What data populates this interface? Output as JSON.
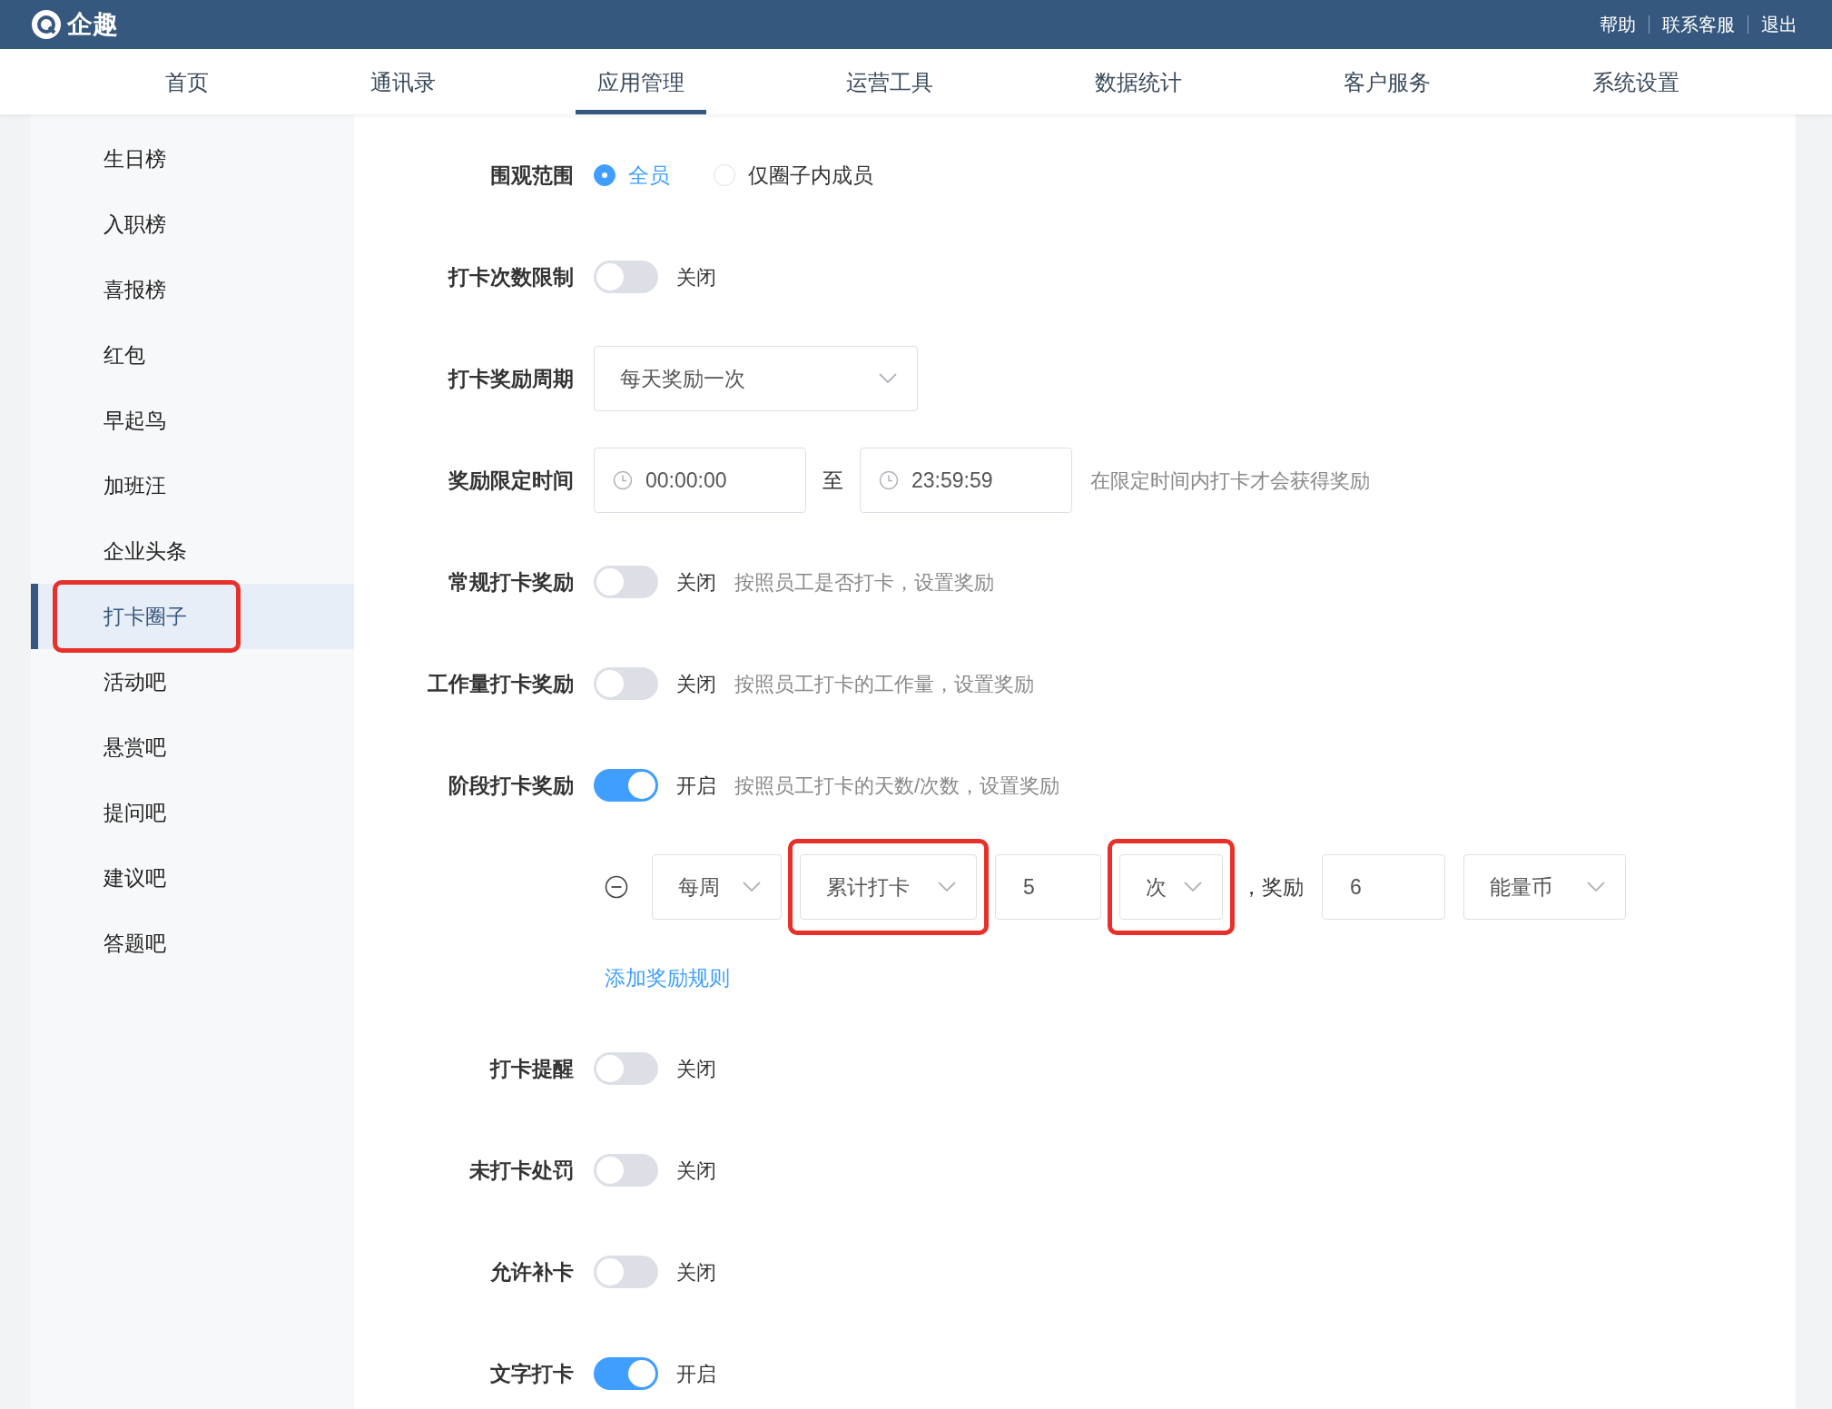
{
  "header": {
    "logo_text": "企趣",
    "links": [
      "帮助",
      "联系客服",
      "退出"
    ]
  },
  "nav": [
    {
      "label": "首页",
      "selected": false
    },
    {
      "label": "通讯录",
      "selected": false
    },
    {
      "label": "应用管理",
      "selected": true
    },
    {
      "label": "运营工具",
      "selected": false
    },
    {
      "label": "数据统计",
      "selected": false
    },
    {
      "label": "客户服务",
      "selected": false
    },
    {
      "label": "系统设置",
      "selected": false
    }
  ],
  "sidebar": {
    "items": [
      {
        "label": "生日榜",
        "selected": false,
        "highlighted": false
      },
      {
        "label": "入职榜",
        "selected": false,
        "highlighted": false
      },
      {
        "label": "喜报榜",
        "selected": false,
        "highlighted": false
      },
      {
        "label": "红包",
        "selected": false,
        "highlighted": false
      },
      {
        "label": "早起鸟",
        "selected": false,
        "highlighted": false
      },
      {
        "label": "加班汪",
        "selected": false,
        "highlighted": false
      },
      {
        "label": "企业头条",
        "selected": false,
        "highlighted": false
      },
      {
        "label": "打卡圈子",
        "selected": true,
        "highlighted": true
      },
      {
        "label": "活动吧",
        "selected": false,
        "highlighted": false
      },
      {
        "label": "悬赏吧",
        "selected": false,
        "highlighted": false
      },
      {
        "label": "提问吧",
        "selected": false,
        "highlighted": false
      },
      {
        "label": "建议吧",
        "selected": false,
        "highlighted": false
      },
      {
        "label": "答题吧",
        "selected": false,
        "highlighted": false
      }
    ]
  },
  "form": {
    "rows": [
      {
        "kind": "radio",
        "label": "围观范围",
        "options": [
          {
            "label": "全员",
            "selected": true
          },
          {
            "label": "仅圈子内成员",
            "selected": false
          }
        ]
      },
      {
        "kind": "toggle",
        "label": "打卡次数限制",
        "on": false,
        "state_text": "关闭"
      },
      {
        "kind": "select",
        "label": "打卡奖励周期",
        "value": "每天奖励一次"
      },
      {
        "kind": "timerange",
        "label": "奖励限定时间",
        "start": "00:00:00",
        "separator": "至",
        "end": "23:59:59",
        "hint": "在限定时间内打卡才会获得奖励"
      },
      {
        "kind": "toggle",
        "label": "常规打卡奖励",
        "on": false,
        "state_text": "关闭",
        "hint": "按照员工是否打卡，设置奖励"
      },
      {
        "kind": "toggle",
        "label": "工作量打卡奖励",
        "on": false,
        "state_text": "关闭",
        "hint": "按照员工打卡的工作量，设置奖励"
      },
      {
        "kind": "toggle",
        "label": "阶段打卡奖励",
        "on": true,
        "state_text": "开启",
        "hint": "按照员工打卡的天数/次数，设置奖励"
      },
      {
        "kind": "rules",
        "rules": [
          {
            "controls": [
              {
                "kind": "select",
                "value": "每周",
                "highlighted": false
              },
              {
                "kind": "select",
                "value": "累计打卡",
                "highlighted": true
              },
              {
                "kind": "input",
                "value": "5"
              },
              {
                "kind": "select",
                "value": "次",
                "highlighted": true
              },
              {
                "kind": "text",
                "value": "，奖励"
              },
              {
                "kind": "input",
                "value": "6"
              },
              {
                "kind": "select",
                "value": "能量币",
                "highlighted": false
              }
            ]
          }
        ],
        "add_link": "添加奖励规则"
      },
      {
        "kind": "toggle",
        "label": "打卡提醒",
        "on": false,
        "state_text": "关闭"
      },
      {
        "kind": "toggle",
        "label": "未打卡处罚",
        "on": false,
        "state_text": "关闭"
      },
      {
        "kind": "toggle",
        "label": "允许补卡",
        "on": false,
        "state_text": "关闭"
      },
      {
        "kind": "toggle",
        "label": "文字打卡",
        "on": true,
        "state_text": "开启"
      }
    ]
  }
}
